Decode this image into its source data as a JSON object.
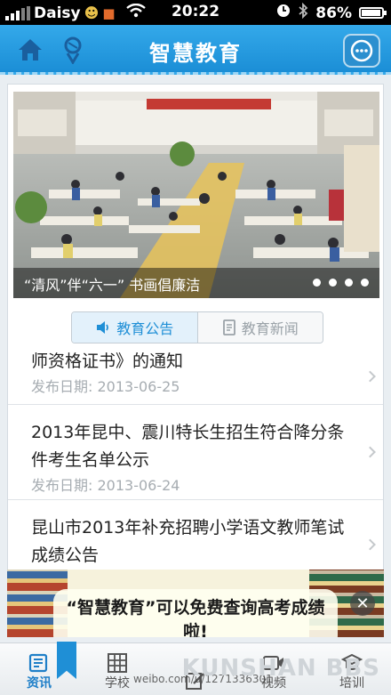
{
  "status": {
    "carrier": "Daisy",
    "time": "20:22",
    "battery": "86%",
    "battery_level": 0.86
  },
  "header": {
    "title": "智慧教育",
    "home_icon": "home-icon",
    "ball_icon": "ball-icon",
    "more_icon": "more-icon"
  },
  "banner": {
    "caption": "“清风”伴“六一” 书画倡廉洁",
    "slides": 4,
    "active_slide": 1
  },
  "tabs": [
    {
      "label": "教育公告",
      "icon": "speaker-icon",
      "active": true
    },
    {
      "label": "教育新闻",
      "icon": "document-icon",
      "active": false
    }
  ],
  "list": [
    {
      "title": "师资格证书》的通知",
      "date": "发布日期: 2013-06-25"
    },
    {
      "title": "2013年昆中、震川特长生招生符合降分条件考生名单公示",
      "date": "发布日期: 2013-06-24"
    },
    {
      "title": "昆山市2013年补充招聘小学语文教师笔试成绩公告",
      "date": ""
    }
  ],
  "ad": {
    "text": "“智慧教育”可以免费查询高考成绩啦!"
  },
  "nav": [
    {
      "label": "资讯",
      "icon": "news-icon",
      "active": true
    },
    {
      "label": "学校",
      "icon": "grid-icon",
      "active": false
    },
    {
      "label": "",
      "icon": "edit-icon",
      "active": false
    },
    {
      "label": "视频",
      "icon": "video-icon",
      "active": false
    },
    {
      "label": "培训",
      "icon": "training-icon",
      "active": false
    }
  ],
  "watermark": "weibo.com/u/1271336301",
  "bbs": "KUNSHAN BBS"
}
